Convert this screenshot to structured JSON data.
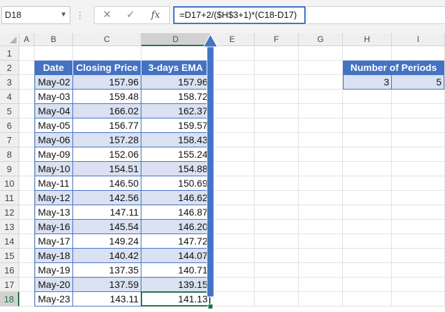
{
  "name_box": {
    "value": "D18"
  },
  "formula_bar": {
    "cancel_symbol": "✕",
    "enter_symbol": "✓",
    "fx_label": "fx",
    "formula": "=D17+2/($H$3+1)*(C18-D17)"
  },
  "columns": [
    "A",
    "B",
    "C",
    "D",
    "E",
    "F",
    "G",
    "H",
    "I"
  ],
  "rows": [
    "1",
    "2",
    "3",
    "4",
    "5",
    "6",
    "7",
    "8",
    "9",
    "10",
    "11",
    "12",
    "13",
    "14",
    "15",
    "16",
    "17",
    "18"
  ],
  "selected_column": "D",
  "selected_row": "18",
  "table": {
    "headers": [
      "Date",
      "Closing Price",
      "3-days EMA"
    ],
    "rows": [
      [
        "May-02",
        "157.96",
        "157.96"
      ],
      [
        "May-03",
        "159.48",
        "158.72"
      ],
      [
        "May-04",
        "166.02",
        "162.37"
      ],
      [
        "May-05",
        "156.77",
        "159.57"
      ],
      [
        "May-06",
        "157.28",
        "158.43"
      ],
      [
        "May-09",
        "152.06",
        "155.24"
      ],
      [
        "May-10",
        "154.51",
        "154.88"
      ],
      [
        "May-11",
        "146.50",
        "150.69"
      ],
      [
        "May-12",
        "142.56",
        "146.62"
      ],
      [
        "May-13",
        "147.11",
        "146.87"
      ],
      [
        "May-16",
        "145.54",
        "146.20"
      ],
      [
        "May-17",
        "149.24",
        "147.72"
      ],
      [
        "May-18",
        "140.42",
        "144.07"
      ],
      [
        "May-19",
        "137.35",
        "140.71"
      ],
      [
        "May-20",
        "137.59",
        "139.15"
      ],
      [
        "May-23",
        "143.11",
        "141.13"
      ]
    ]
  },
  "periods_table": {
    "header": "Number of Periods",
    "values": [
      "3",
      "5"
    ]
  },
  "colors": {
    "table_header": "#4472c4",
    "table_band": "#d9e1f2",
    "selection": "#217346",
    "arrow": "#4472c4"
  }
}
